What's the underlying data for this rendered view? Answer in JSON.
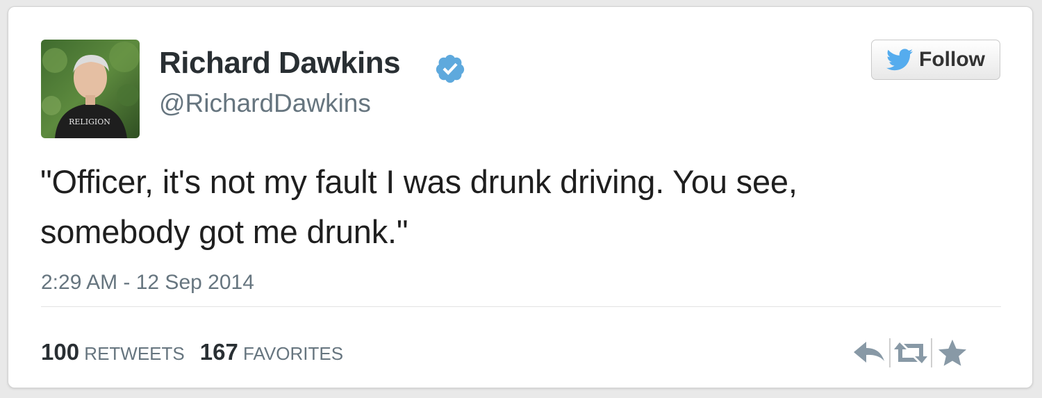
{
  "tweet": {
    "author": {
      "display_name": "Richard Dawkins",
      "handle": "@RichardDawkins",
      "verified": true,
      "avatar_shirt_text": "RELIGION"
    },
    "follow_button": {
      "label": "Follow",
      "icon": "twitter-bird-icon"
    },
    "text_lines": [
      "\"Officer, it's not my fault I was drunk driving. You see,",
      "somebody got me drunk.\""
    ],
    "timestamp": "2:29 AM - 12 Sep 2014",
    "stats": {
      "retweets_count": "100",
      "retweets_label": "RETWEETS",
      "favorites_count": "167",
      "favorites_label": "FAVORITES"
    },
    "actions": [
      {
        "name": "reply",
        "icon": "reply-icon"
      },
      {
        "name": "retweet",
        "icon": "retweet-icon"
      },
      {
        "name": "favorite",
        "icon": "star-icon"
      }
    ]
  },
  "colors": {
    "twitter_blue": "#55acee",
    "verified_blue": "#5ea9dd",
    "text_dark": "#292f33",
    "text_muted": "#66757f",
    "action_gray": "#8899a6"
  }
}
